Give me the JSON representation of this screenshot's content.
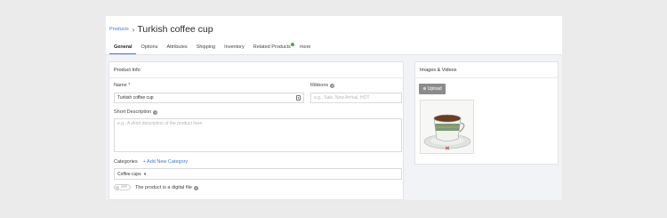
{
  "breadcrumb": {
    "parent": "Products",
    "separator": "›",
    "title": "Turkish coffee cup"
  },
  "tabs": [
    {
      "label": "General",
      "active": true
    },
    {
      "label": "Options"
    },
    {
      "label": "Attributes"
    },
    {
      "label": "Shipping"
    },
    {
      "label": "Inventory"
    },
    {
      "label": "Related Products",
      "badge": true
    },
    {
      "label": "more"
    }
  ],
  "product_info": {
    "header": "Product Info",
    "name_label": "Name *",
    "name_value": "Turkish coffee cup",
    "ribbons_label": "Ribbons",
    "ribbons_placeholder": "e.g., Sale, New Arrival, HOT",
    "short_desc_label": "Short Description",
    "short_desc_placeholder": "e.g., A short description of the product here",
    "categories_label": "Categories",
    "add_category": "+ Add New Category",
    "category_value": "Coffee cups",
    "digital_toggle": "OFF",
    "digital_label": "The product is a digital file"
  },
  "media": {
    "header": "Images & Videos",
    "upload_label": "Upload"
  },
  "colors": {
    "accent": "#3a7bd5",
    "badge": "#5aa05a"
  }
}
